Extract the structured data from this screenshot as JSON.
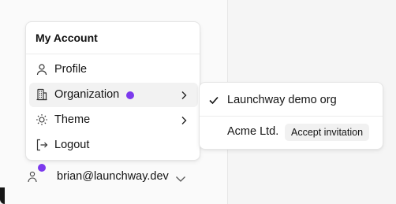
{
  "menu": {
    "title": "My Account",
    "items": [
      {
        "label": "Profile",
        "icon": "user-icon"
      },
      {
        "label": "Organization",
        "icon": "building-icon",
        "has_notification": true,
        "has_submenu": true
      },
      {
        "label": "Theme",
        "icon": "sun-icon",
        "has_submenu": true
      },
      {
        "label": "Logout",
        "icon": "logout-icon"
      }
    ]
  },
  "submenu": {
    "orgs": [
      {
        "name": "Launchway demo org",
        "selected": true
      },
      {
        "name": "Acme Ltd.",
        "selected": false,
        "action": "Accept invitation"
      }
    ]
  },
  "user": {
    "email": "brian@launchway.dev",
    "has_notification": true
  },
  "colors": {
    "accent": "#7c3aed",
    "active_row": "#f2f2f2",
    "border": "#e5e5e5"
  }
}
